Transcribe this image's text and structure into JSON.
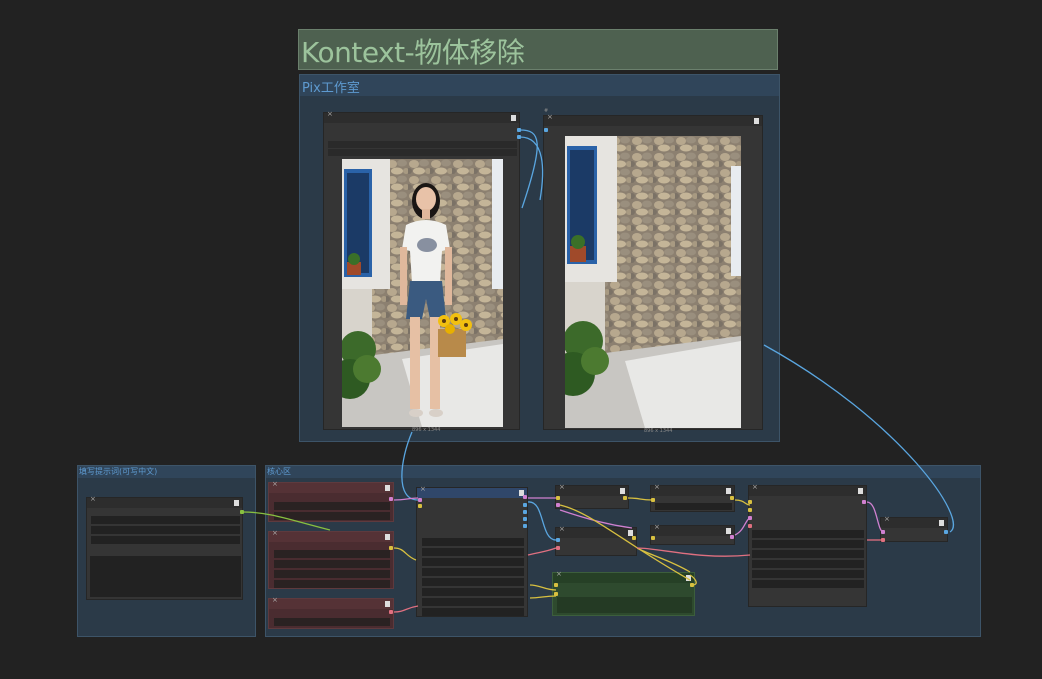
{
  "canvas": {
    "title_node": "Kontext-物体移除",
    "groups": {
      "studio": "Pix工作室",
      "prompt": "填写提示词(可写中文)",
      "core": "核心区"
    },
    "preview": {
      "left_size": "896 x 1344",
      "right_size": "896 x 1344"
    }
  },
  "colors": {
    "background": "#222222",
    "group": "#2b3a48",
    "group_title": "#5e9ad0",
    "title_node": "#4e6150",
    "wire_blue": "#5aa6e0",
    "wire_yellow": "#d8c040",
    "wire_pink": "#e07080",
    "wire_green": "#88c040"
  }
}
